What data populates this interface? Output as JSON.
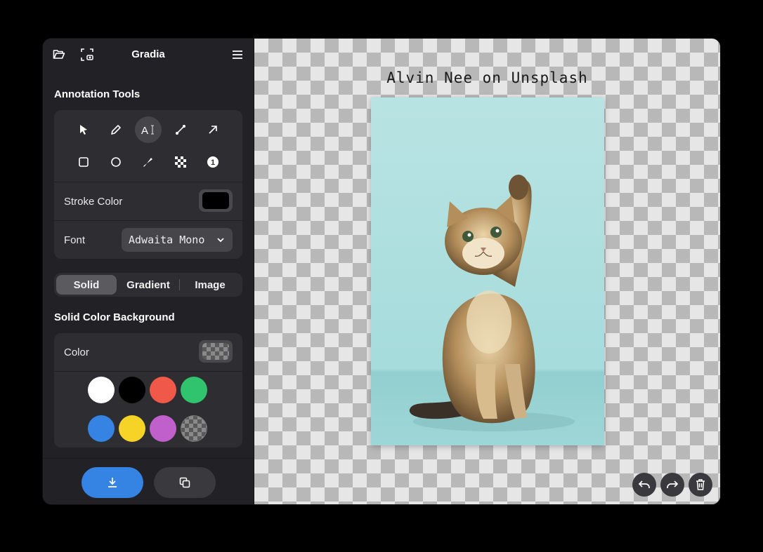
{
  "app": {
    "title": "Gradia"
  },
  "annotation": {
    "section_title": "Annotation Tools",
    "tools": [
      {
        "name": "select"
      },
      {
        "name": "pen"
      },
      {
        "name": "text"
      },
      {
        "name": "line"
      },
      {
        "name": "arrow"
      },
      {
        "name": "rectangle"
      },
      {
        "name": "circle"
      },
      {
        "name": "highlighter"
      },
      {
        "name": "censor"
      },
      {
        "name": "number"
      }
    ],
    "active_tool": "text",
    "stroke_color_label": "Stroke Color",
    "stroke_color": "#000000",
    "font_label": "Font",
    "font_value": "Adwaita Mono"
  },
  "background": {
    "modes": [
      "Solid",
      "Gradient",
      "Image"
    ],
    "active_mode": "Solid",
    "section_title": "Solid Color Background",
    "color_label": "Color",
    "palette": [
      "#ffffff",
      "#000000",
      "#f0594a",
      "#2fc46d",
      "#3584e4",
      "#f5d327",
      "#c061cb",
      "transparent"
    ]
  },
  "canvas": {
    "caption": "Alvin Nee on Unsplash",
    "photo_subject": "kitten raising paw"
  },
  "icons": {
    "open": "folder-open-icon",
    "screenshot": "screenshot-icon",
    "menu": "hamburger-menu-icon",
    "export": "download-icon",
    "copy": "copy-icon",
    "undo": "undo-icon",
    "redo": "redo-icon",
    "delete": "trash-icon",
    "close": "close-icon"
  },
  "colors": {
    "accent": "#3584e4",
    "sidebar_bg": "#222226",
    "card_bg": "#2e2e32"
  }
}
